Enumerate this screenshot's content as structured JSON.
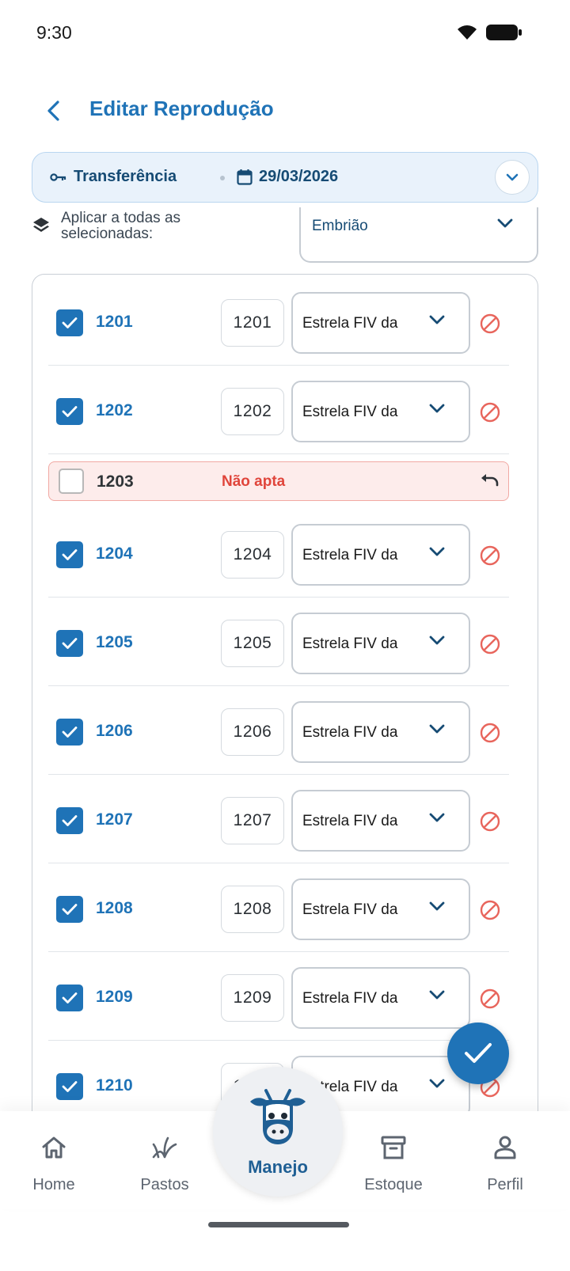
{
  "status_bar": {
    "time": "9:30"
  },
  "header": {
    "title": "Editar Reprodução"
  },
  "summary": {
    "type_label": "Transferência",
    "date": "29/03/2026"
  },
  "apply_all": {
    "label": "Aplicar a todas as selecionadas:",
    "selected_value": "Embrião"
  },
  "rows": [
    {
      "id": "1201",
      "input_value": "1201",
      "select_value": "Estrela FIV da",
      "checked": true
    },
    {
      "id": "1202",
      "input_value": "1202",
      "select_value": "Estrela FIV da",
      "checked": true
    },
    {
      "id": "1204",
      "input_value": "1204",
      "select_value": "Estrela FIV da",
      "checked": true
    },
    {
      "id": "1205",
      "input_value": "1205",
      "select_value": "Estrela FIV da",
      "checked": true
    },
    {
      "id": "1206",
      "input_value": "1206",
      "select_value": "Estrela FIV da",
      "checked": true
    },
    {
      "id": "1207",
      "input_value": "1207",
      "select_value": "Estrela FIV da",
      "checked": true
    },
    {
      "id": "1208",
      "input_value": "1208",
      "select_value": "Estrela FIV da",
      "checked": true
    },
    {
      "id": "1209",
      "input_value": "1209",
      "select_value": "Estrela FIV da",
      "checked": true
    },
    {
      "id": "1210",
      "input_value": "1210",
      "select_value": "Estrela FIV da",
      "checked": true
    }
  ],
  "invalid_row": {
    "id": "1203",
    "status": "Não apta",
    "checked": false
  },
  "bottom_nav": {
    "home": "Home",
    "pastos": "Pastos",
    "manejo": "Manejo",
    "estoque": "Estoque",
    "perfil": "Perfil"
  },
  "colors": {
    "primary": "#1f73b7",
    "danger": "#e0453b",
    "invalid_bg": "#fdeceb"
  }
}
